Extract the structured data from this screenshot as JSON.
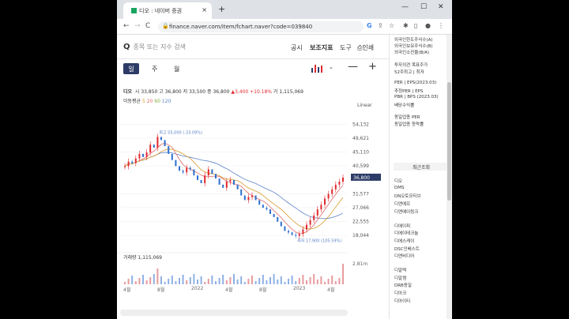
{
  "browser": {
    "tab_title": "디오 : 네이버 증권",
    "new_tab": "+",
    "tab_close": "×",
    "url": "finance.naver.com/item/fchart.naver?code=039840",
    "back": "←",
    "forward": "→",
    "reload": "C",
    "min": "—",
    "max": "☐",
    "close": "✕"
  },
  "toolbar": {
    "search_icon": "Q",
    "search_placeholder": "종목 또는 지수 검색",
    "disclosure": "공시",
    "indicator": "보조지표",
    "tools": "도구",
    "print_icon": "⎙",
    "print": "인쇄"
  },
  "periods": {
    "day": "일",
    "week": "주",
    "month": "월"
  },
  "zoom": {
    "minus": "—",
    "plus": "+",
    "dropdown": "⌄"
  },
  "quote": {
    "name": "디오",
    "start_label": "시",
    "start": "33,850",
    "high_label": "고",
    "high": "36,800",
    "low_label": "저",
    "low": "33,500",
    "close_label": "종",
    "close": "36,800",
    "change": "▲3,400",
    "change_pct": "+10.18%",
    "vol_label": "거",
    "volume": "1,115,069"
  },
  "ma": {
    "label": "이동평균",
    "m5": "5",
    "m20": "20",
    "m60": "60",
    "m120": "120"
  },
  "scale_mode": "Linear",
  "volume_label": "거래량 1,115,069",
  "chart_data": {
    "type": "line",
    "yticks": [
      "54,132",
      "49,621",
      "45,110",
      "40,599",
      "31,577",
      "27,066",
      "22,555",
      "18,044"
    ],
    "current_price": "36,800",
    "max_annotation": "최고 55,000 (-33.09%)",
    "min_annotation": "최저 17,900 (105.59%)",
    "volume_tick": "2.81m",
    "xticks": [
      "4월",
      "8월",
      "2022",
      "4월",
      "8월",
      "2023",
      "4월"
    ],
    "series": [
      {
        "values": [
          40500,
          42000,
          41500,
          43000,
          44500,
          43500,
          45000,
          47500,
          46500,
          50000,
          49000,
          47000,
          44500,
          42500,
          40500,
          39000,
          38500,
          40000,
          39500,
          37500,
          36000,
          35000,
          37500,
          39500,
          38000,
          36500,
          34500,
          33500,
          35500,
          36000,
          34500,
          33000,
          31000,
          29500,
          30500,
          31000,
          29500,
          28000,
          27000,
          26500,
          25000,
          24000,
          22500,
          21000,
          19500,
          19000,
          18200,
          17900,
          18500,
          20000,
          21500,
          23000,
          24500,
          26500,
          28000,
          30000,
          31500,
          33000,
          34500,
          35500,
          36800
        ]
      }
    ]
  },
  "side": {
    "items": [
      "외국인한도주식수(A)",
      "외국인보유주식수(B)",
      "외국인소진율(B/A)",
      "투자의견  목표주가",
      "52주최고 | 최저",
      "PER | EPS(2023.03)",
      "추정PER | EPS",
      "PBR | BPS (2023.03)",
      "배당수익률",
      "동일업종 PER",
      "동일업종 등락률"
    ],
    "recent_title": "최근조회",
    "recent": [
      "디오",
      "DMS",
      "DN오토모티브",
      "디엔에프",
      "디엔에이링크",
      "디에이피",
      "디에이테크놀",
      "디에스케이",
      "DSC인베스트",
      "디엔비디어",
      "디알텍",
      "디알젬",
      "DRB동일",
      "디아크",
      "디아이티"
    ]
  },
  "colors": {
    "up": "#e0292e",
    "navy": "#2d3b67"
  }
}
